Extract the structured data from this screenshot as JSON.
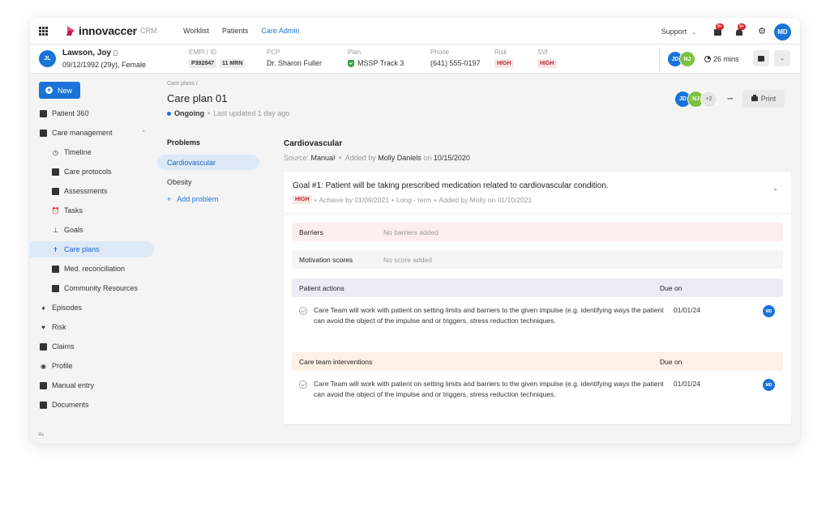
{
  "topnav": {
    "brand": "innovaccer",
    "product": "CRM",
    "links": [
      {
        "label": "Worklist",
        "active": false
      },
      {
        "label": "Patients",
        "active": false
      },
      {
        "label": "Care Admin",
        "active": true
      }
    ],
    "support_label": "Support",
    "messages_badge": "9+",
    "alerts_badge": "9+",
    "user_initials": "MD"
  },
  "patient": {
    "initials": "JL",
    "name": "Lawson, Joy",
    "dob": "09/12/1992 (29y), Female",
    "empi_label": "EMPI / ID",
    "empi": "P392847",
    "mrn": "11 MRN",
    "pcp_label": "PCP",
    "pcp": "Dr. Sharon Fuller",
    "plan_label": "Plan",
    "plan": "MSSP Track 3",
    "phone_label": "Phone",
    "phone": "(641) 555-0197",
    "risk_label": "Risk",
    "risk": "HIGH",
    "svi_label": "SVI",
    "svi": "HIGH",
    "care_team": [
      "JD",
      "NJ"
    ],
    "timer": "26 mins"
  },
  "sidebar": {
    "new_label": "New",
    "items": [
      {
        "label": "Patient 360"
      },
      {
        "label": "Care management"
      },
      {
        "label": "Timeline"
      },
      {
        "label": "Care protocols"
      },
      {
        "label": "Assessments"
      },
      {
        "label": "Tasks"
      },
      {
        "label": "Goals"
      },
      {
        "label": "Care plans"
      },
      {
        "label": "Med. reconciliation"
      },
      {
        "label": "Community Resources"
      },
      {
        "label": "Episodes"
      },
      {
        "label": "Risk"
      },
      {
        "label": "Claims"
      },
      {
        "label": "Profile"
      },
      {
        "label": "Manual entry"
      },
      {
        "label": "Documents"
      }
    ]
  },
  "careplan": {
    "breadcrumb": "Care plans /",
    "title": "Care plan 01",
    "status": "Ongoing",
    "last_updated": "Last updated 1 day ago",
    "team": [
      "JD",
      "NJ"
    ],
    "team_more": "+2",
    "print_label": "Print"
  },
  "problems": {
    "title": "Problems",
    "items": [
      "Cardiovascular",
      "Obesity"
    ],
    "add_label": "Add problem"
  },
  "problem_detail": {
    "title": "Cardiovascular",
    "source_label": "Source:",
    "source": "Manual",
    "added_by_label": "Added by",
    "added_by": "Molly Daniels",
    "on_label": "on",
    "date": "10/15/2020",
    "goal": {
      "title": "Goal #1: Patient will be taking prescribed medication related to cardiovascular condition.",
      "priority": "HIGH",
      "achieve_by": "Achieve by 01/09/2021",
      "term": "Long - term",
      "added": "Added by Molly on 01/10/2021"
    },
    "barriers": {
      "label": "Barriers",
      "value": "No barriers added"
    },
    "motivation": {
      "label": "Motivation scores",
      "value": "No score added"
    },
    "patient_actions": {
      "label": "Patient actions",
      "due_label": "Due on",
      "rows": [
        {
          "text": "Care Team will work with patient on setting limits and barriers to the given impulse (e.g. identifying ways the patient can avoid the object of the impulse and or triggers, stress reduction techniques.",
          "due": "01/01/24",
          "assignee": "MD"
        }
      ]
    },
    "interventions": {
      "label": "Care team interventions",
      "due_label": "Due on",
      "rows": [
        {
          "text": "Care Team will work with patient on setting limits and barriers to the given impulse (e.g. identifying ways the patient can avoid the object of the impulse and or triggers, stress reduction techniques.",
          "due": "01/01/24",
          "assignee": "MD"
        }
      ]
    }
  },
  "colors": {
    "primary": "#1a73d9",
    "high_bg": "#fbe5e6",
    "high_text": "#b3262e",
    "active_bg": "#dde9f7"
  }
}
